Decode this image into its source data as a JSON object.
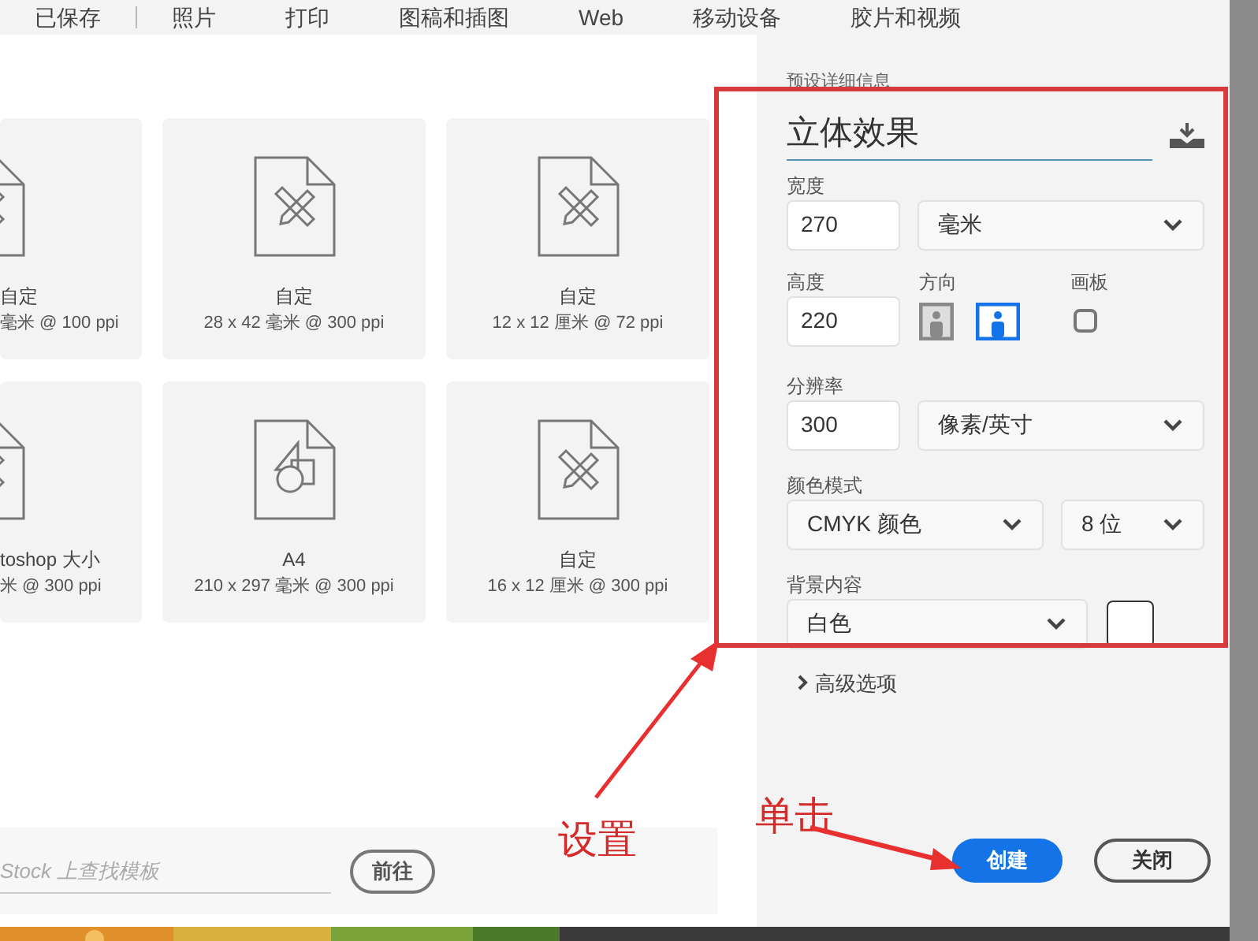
{
  "tabs": [
    {
      "label": "已保存",
      "selected": false
    },
    {
      "label": "照片",
      "selected": false
    },
    {
      "label": "打印",
      "selected": false
    },
    {
      "label": "图稿和插图",
      "selected": false
    },
    {
      "label": "Web",
      "selected": false
    },
    {
      "label": "移动设备",
      "selected": false
    },
    {
      "label": "胶片和视频",
      "selected": false
    }
  ],
  "presets": [
    {
      "kind": "ruler",
      "name": "自定",
      "size": "毫米 @ 100 ppi"
    },
    {
      "kind": "ruler",
      "name": "自定",
      "size": "28 x 42 毫米 @ 300 ppi"
    },
    {
      "kind": "ruler",
      "name": "自定",
      "size": "12 x 12 厘米 @ 72 ppi"
    },
    {
      "kind": "ruler",
      "name": "toshop 大小",
      "size": "米 @ 300 ppi"
    },
    {
      "kind": "shapes",
      "name": "A4",
      "size": "210 x 297 毫米 @ 300 ppi"
    },
    {
      "kind": "ruler",
      "name": "自定",
      "size": "16 x 12 厘米 @ 300 ppi"
    }
  ],
  "stock_search": {
    "placeholder": "Stock 上查找模板",
    "button": "前往"
  },
  "details": {
    "header": "预设详细信息",
    "name": "立体效果",
    "width": {
      "label": "宽度",
      "value": "270",
      "unit": "毫米"
    },
    "height": {
      "label": "高度",
      "value": "220"
    },
    "orientation": {
      "label": "方向",
      "options": [
        {
          "kind": "portrait",
          "selected": false
        },
        {
          "kind": "landscape",
          "selected": true
        }
      ]
    },
    "artboard": {
      "label": "画板",
      "checked": false
    },
    "resolution": {
      "label": "分辨率",
      "value": "300",
      "unit": "像素/英寸"
    },
    "color_mode": {
      "label": "颜色模式",
      "mode": "CMYK 颜色",
      "depth": "8 位"
    },
    "background": {
      "label": "背景内容",
      "value": "白色",
      "color": "#ffffff"
    },
    "advanced": {
      "label": "高级选项",
      "expanded": false
    }
  },
  "buttons": [
    {
      "label": "创建",
      "kind": "primary"
    },
    {
      "label": "关闭",
      "kind": "secondary"
    }
  ],
  "annotations": [
    {
      "text": "设置"
    },
    {
      "text": "单击"
    }
  ]
}
